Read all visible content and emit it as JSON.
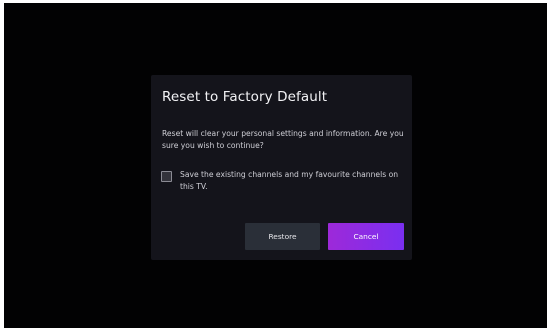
{
  "dialog": {
    "title": "Reset to Factory Default",
    "message": "Reset will clear your personal settings and information. Are you sure you wish to continue?",
    "save_option": {
      "label": "Save the existing channels and my favourite channels on this TV.",
      "checked": false
    },
    "buttons": {
      "restore_label": "Restore",
      "cancel_label": "Cancel"
    }
  },
  "colors": {
    "background": "#020203",
    "dialog_background": "#14141b",
    "restore_button": "#2a2f38",
    "cancel_button_start": "#9d29d9",
    "cancel_button_end": "#7a2ff0"
  }
}
